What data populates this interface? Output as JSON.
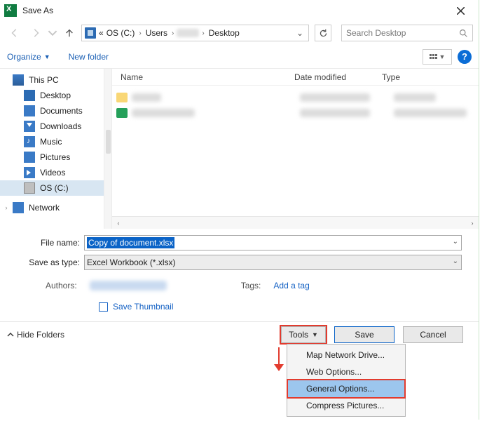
{
  "title": "Save As",
  "breadcrumb": {
    "pre": "«",
    "drive": "OS (C:)",
    "users": "Users",
    "desk": "Desktop"
  },
  "search": {
    "placeholder": "Search Desktop"
  },
  "toolbar": {
    "organize": "Organize",
    "newfolder": "New folder"
  },
  "tree": {
    "thispc": "This PC",
    "desktop": "Desktop",
    "documents": "Documents",
    "downloads": "Downloads",
    "music": "Music",
    "pictures": "Pictures",
    "videos": "Videos",
    "osc": "OS (C:)",
    "network": "Network"
  },
  "cols": {
    "name": "Name",
    "date": "Date modified",
    "type": "Type"
  },
  "form": {
    "filename_label": "File name:",
    "filename_value": "Copy of document.xlsx",
    "type_label": "Save as type:",
    "type_value": "Excel Workbook (*.xlsx)",
    "authors_label": "Authors:",
    "tags_label": "Tags:",
    "tags_value": "Add a tag",
    "thumb": "Save Thumbnail"
  },
  "buttons": {
    "hide": "Hide Folders",
    "tools": "Tools",
    "save": "Save",
    "cancel": "Cancel"
  },
  "menu": {
    "map": "Map Network Drive...",
    "web": "Web Options...",
    "gen": "General Options...",
    "comp": "Compress Pictures..."
  }
}
